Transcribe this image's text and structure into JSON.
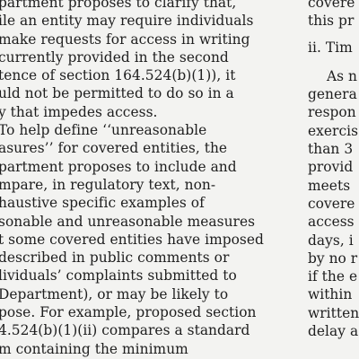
{
  "left_column": {
    "lines": [
      "partment proposes to clarify that,",
      "ile an entity may require individuals",
      "make requests for access in writing",
      "currently provided in the second",
      "tence of section 164.524(b)(1)), it",
      "uld not be permitted to do so in a",
      "y that impedes access.",
      "To help define ‘‘unreasonable",
      "asures’’ for covered entities, the",
      "partment proposes to include and",
      "mpare, in regulatory text, non-",
      "haustive specific examples of",
      "sonable and unreasonable measures",
      "t some covered entities have imposed",
      "described in public comments or",
      "lividuals’ complaints submitted to",
      "Department), or may be likely to",
      "pose. For example, proposed section",
      "4.524(b)(1)(ii) compares a standard",
      "m containing the minimum"
    ]
  },
  "right_column": {
    "lines_before_heading": [
      "covere",
      "this pr"
    ],
    "heading": "ii. Tim",
    "lines_after_heading": [
      "As n",
      "genera",
      "respon",
      "exercis",
      "than 3",
      "provid",
      "meets",
      "covere",
      "access",
      "days, i",
      "by no r",
      "if the e",
      "within",
      "written",
      "delay a"
    ]
  }
}
